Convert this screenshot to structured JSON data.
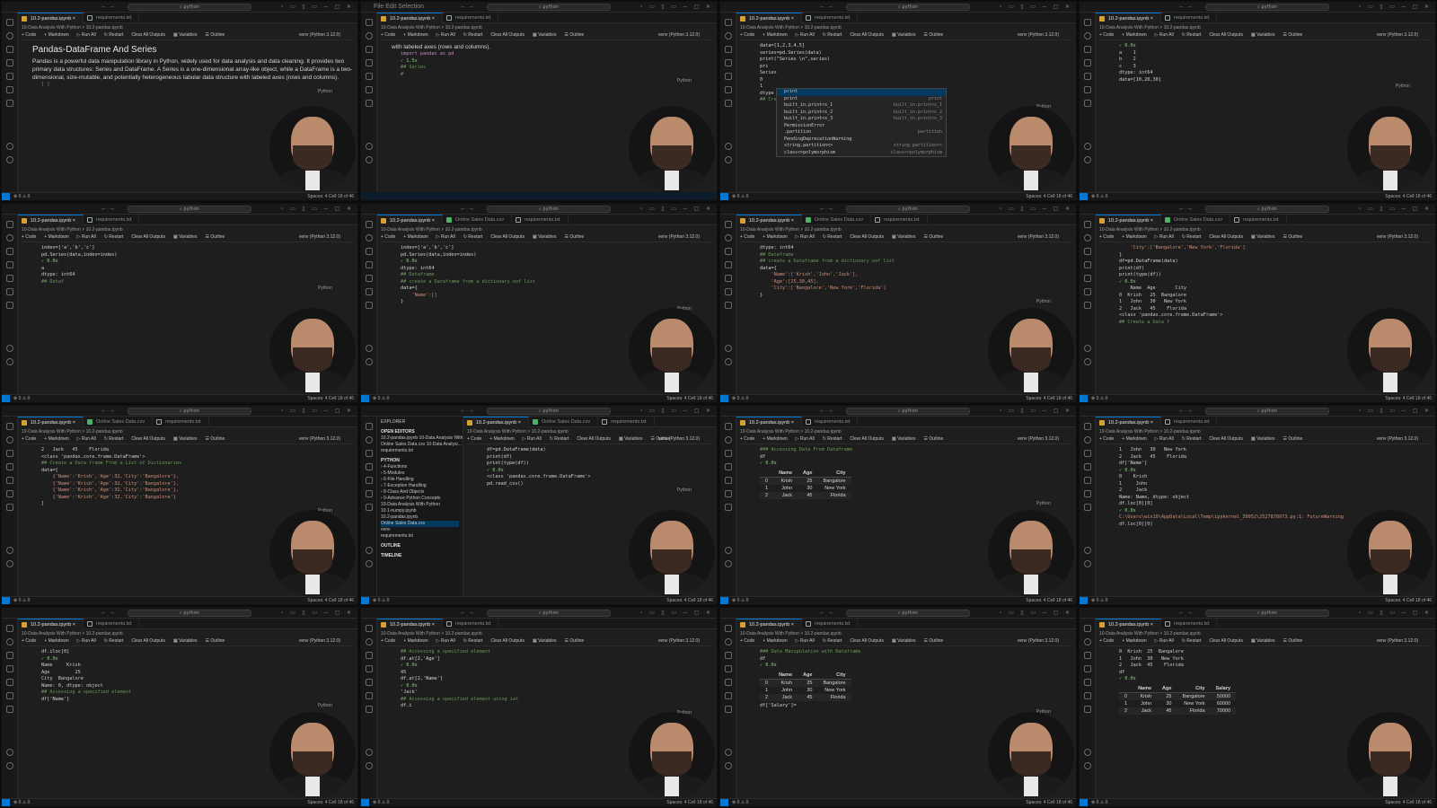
{
  "common": {
    "search": "python",
    "nb_tab": "10.2-pandas.ipynb",
    "req_tab": "requirements.txt",
    "csv_tab": "Online Sales Data.csv",
    "crumbs": "10-Data Analysis With Python > 10.2-pandas.ipynb",
    "tb_code": "+ Code",
    "tb_md": "+ Markdown",
    "tb_run": "Run All",
    "tb_restart": "Restart",
    "tb_clear": "Clear All Outputs",
    "tb_vars": "Variables",
    "tb_outline": "Outline",
    "kernel": "venv (Python 3.12.0)",
    "lang": "Python",
    "status_left": "⊗ 0 ⚠ 0",
    "status_right": "Spaces: 4   Cell 18 of 46",
    "menu": "File  Edit  Selection"
  },
  "explorer": {
    "header": "EXPLORER",
    "open_editors": "OPEN EDITORS",
    "items": [
      "10.2-pandas.ipynb  10-Data Analysis With Py...",
      "Online Sales Data.csv  10-Data Analysi...",
      "requirements.txt",
      "PYTHON",
      "4-Functions",
      "5-Modules",
      "6-File Handling",
      "7-Exception Handling",
      "8-Class And Objects",
      "9-Advance Python Concepts",
      "10-Data Analysis With Python",
      "10.1-numpy.ipynb",
      "10.2-pandas.ipynb",
      "Online Sales Data.csv",
      "venv",
      "requirements.txt"
    ],
    "outline": "OUTLINE",
    "timeline": "TIMELINE"
  },
  "suggest": [
    {
      "label": "print",
      "detail": ""
    },
    {
      "label": "print",
      "detail": "print"
    },
    {
      "label": "built_in.print<s_1",
      "detail": "built_in.print<s_1"
    },
    {
      "label": "built_in.print<s_2",
      "detail": "built_in.print<s_2"
    },
    {
      "label": "built_in.print<s_3",
      "detail": "built_in.print<s_3"
    },
    {
      "label": "PermissionError",
      "detail": ""
    },
    {
      "label": ".partition",
      "detail": "partition"
    },
    {
      "label": "PendingDeprecationWarning",
      "detail": ""
    },
    {
      "label": "string.partition<>",
      "detail": "string.partition<>"
    },
    {
      "label": "class<>polymorphism",
      "detail": "class<>polymorphism"
    }
  ],
  "panels": [
    {
      "lines": [
        {
          "c": "h",
          "t": "Pandas-DataFrame And Series"
        },
        {
          "c": "md",
          "t": "Pandas is a powerful data manipulation library in Python, widely used for data analysis and data cleaning. It provides two primary data structures: Series and DataFrame. A Series is a one-dimensional array-like object, while a DataFrame is a two-dimensional, size-mutable, and potentially heterogeneous tabular data structure with labeled axes (rows and columns)."
        },
        {
          "c": "cellbar",
          "t": "[ ]"
        }
      ]
    },
    {
      "lines": [
        {
          "c": "md",
          "t": "with labeled axes (rows and columns)."
        },
        {
          "c": "kw",
          "t": "import pandas as pd"
        },
        {
          "c": "ok",
          "t": "✓ 1.5s"
        },
        {
          "c": "cmt",
          "t": "## Series"
        },
        {
          "c": "cmt",
          "t": "#"
        }
      ]
    },
    {
      "lines": [
        {
          "c": "",
          "t": "data=[1,2,3,4,5]"
        },
        {
          "c": "",
          "t": "series=pd.Series(data)"
        },
        {
          "c": "",
          "t": "print(\"Series \\n\",series)"
        },
        {
          "c": "",
          "t": "pri"
        },
        {
          "c": "out",
          "t": "Series"
        },
        {
          "c": "out",
          "t": "0"
        },
        {
          "c": "out",
          "t": "1"
        },
        {
          "c": "out",
          "t": "dtype"
        },
        {
          "c": "cmt",
          "t": "## Create a Series from dictionary"
        }
      ]
    },
    {
      "lines": [
        {
          "c": "ok",
          "t": "✓ 0.0s"
        },
        {
          "c": "out",
          "t": "a    1"
        },
        {
          "c": "out",
          "t": "b    2"
        },
        {
          "c": "out",
          "t": "c    3"
        },
        {
          "c": "out",
          "t": "dtype: int64"
        },
        {
          "c": "",
          "t": "data=[10,20,30]"
        }
      ]
    },
    {
      "lines": [
        {
          "c": "",
          "t": "index=['a','b','c']"
        },
        {
          "c": "",
          "t": "pd.Series(data,index=index)"
        },
        {
          "c": "ok",
          "t": "✓ 0.0s"
        },
        {
          "c": "out",
          "t": "a"
        },
        {
          "c": "out",
          "t": "dtype: int64"
        },
        {
          "c": "cmt",
          "t": "## Dataf"
        }
      ]
    },
    {
      "lines": [
        {
          "c": "",
          "t": "index=['a','b','c']"
        },
        {
          "c": "",
          "t": "pd.Series(data,index=index)"
        },
        {
          "c": "ok",
          "t": "✓ 0.0s"
        },
        {
          "c": "out",
          "t": "dtype: int64"
        },
        {
          "c": "cmt",
          "t": "## Dataframe"
        },
        {
          "c": "cmt",
          "t": "## create a Dataframe from a dictionary oof list"
        },
        {
          "c": "",
          "t": "data={"
        },
        {
          "c": "str",
          "t": "    'Name':[]"
        },
        {
          "c": "",
          "t": "}"
        }
      ]
    },
    {
      "lines": [
        {
          "c": "out",
          "t": "dtype: int64"
        },
        {
          "c": "cmt",
          "t": "## Dataframe"
        },
        {
          "c": "cmt",
          "t": "## create a Dataframe from a dictionary oof list"
        },
        {
          "c": "",
          "t": "data={"
        },
        {
          "c": "str",
          "t": "    'Name':['Krish','John','Jack'],"
        },
        {
          "c": "str",
          "t": "    'Age':[25,30,45],"
        },
        {
          "c": "str",
          "t": "    'City':['Bangalore','New York','Florida']"
        },
        {
          "c": "",
          "t": "}"
        }
      ]
    },
    {
      "lines": [
        {
          "c": "str",
          "t": "    'City':['Bangalore','New York','Florida']"
        },
        {
          "c": "",
          "t": "}"
        },
        {
          "c": "",
          "t": "df=pd.DataFrame(data)"
        },
        {
          "c": "",
          "t": "print(df)"
        },
        {
          "c": "",
          "t": "print(type(df))"
        },
        {
          "c": "ok",
          "t": "✓ 0.0s"
        },
        {
          "c": "out",
          "t": "    Name  Age       City"
        },
        {
          "c": "out",
          "t": "0  Krish   25  Bangalore"
        },
        {
          "c": "out",
          "t": "1   John   30   New York"
        },
        {
          "c": "out",
          "t": "2   Jack   45    Florida"
        },
        {
          "c": "out",
          "t": "<class 'pandas.core.frame.DataFrame'>"
        },
        {
          "c": "cmt",
          "t": "## Create a Data f"
        }
      ]
    },
    {
      "lines": [
        {
          "c": "out",
          "t": "2   Jack   45    Florida"
        },
        {
          "c": "out",
          "t": "<class 'pandas.core.frame.DataFrame'>"
        },
        {
          "c": "cmt",
          "t": "## Create a Data frame From a List of Dictionaries"
        },
        {
          "c": "",
          "t": "data=["
        },
        {
          "c": "str",
          "t": "    {'Name':'Krish','Age':32,'City':'Bangalore'},"
        },
        {
          "c": "str",
          "t": "    {'Name':'Krish','Age':32,'City':'Bangalore'},"
        },
        {
          "c": "str",
          "t": "    {'Name':'Krish','Age':32,'City':'Bangalore'},"
        },
        {
          "c": "str",
          "t": "    {'Name':'Krish','Age':32,'City':'Bangalore'}"
        },
        {
          "c": "",
          "t": "]"
        }
      ]
    },
    {
      "lines": [
        {
          "c": "",
          "t": "df=pd.DataFrame(data)"
        },
        {
          "c": "",
          "t": "print(df)"
        },
        {
          "c": "",
          "t": "print(type(df))"
        },
        {
          "c": "ok",
          "t": "✓ 0.0s"
        },
        {
          "c": "out",
          "t": "<class 'pandas.core.frame.DataFrame'>"
        },
        {
          "c": "",
          "t": "pd.read_csv()"
        }
      ]
    },
    {
      "lines": [
        {
          "c": "cmt",
          "t": "### Accessing Data From Dataframe"
        },
        {
          "c": "",
          "t": "df"
        },
        {
          "c": "ok",
          "t": "✓ 0.0s"
        }
      ],
      "table": {
        "cols": [
          "",
          "Name",
          "Age",
          "City"
        ],
        "rows": [
          [
            "0",
            "Krish",
            "25",
            "Bangalore"
          ],
          [
            "1",
            "John",
            "30",
            "New York"
          ],
          [
            "2",
            "Jack",
            "45",
            "Florida"
          ]
        ]
      }
    },
    {
      "lines": [
        {
          "c": "out",
          "t": "1   John   30   New York"
        },
        {
          "c": "out",
          "t": "2   Jack   45    Florida"
        },
        {
          "c": "",
          "t": "df['Name']"
        },
        {
          "c": "ok",
          "t": "✓ 0.0s"
        },
        {
          "c": "out",
          "t": "0    Krish"
        },
        {
          "c": "out",
          "t": "1     John"
        },
        {
          "c": "out",
          "t": "2     Jack"
        },
        {
          "c": "out",
          "t": "Name: Name, dtype: object"
        },
        {
          "c": "",
          "t": "df.loc[0][0]"
        },
        {
          "c": "ok",
          "t": "✓ 0.0s"
        },
        {
          "c": "str",
          "t": "C:\\Users\\win10\\AppData\\Local\\Temp\\ipykernel_30952\\2527878973.py:1: FutureWarning"
        },
        {
          "c": "out",
          "t": "df.loc[0][0]"
        }
      ]
    },
    {
      "lines": [
        {
          "c": "",
          "t": "df.iloc[0]"
        },
        {
          "c": "ok",
          "t": "✓ 0.0s"
        },
        {
          "c": "out",
          "t": "Name     Krish"
        },
        {
          "c": "out",
          "t": "Age         25"
        },
        {
          "c": "out",
          "t": "City  Bangalore"
        },
        {
          "c": "out",
          "t": "Name: 0, dtype: object"
        },
        {
          "c": "cmt",
          "t": "## Accessing a specified element"
        },
        {
          "c": "",
          "t": "df['Name']"
        }
      ]
    },
    {
      "lines": [
        {
          "c": "cmt",
          "t": "## Accessing a specified element"
        },
        {
          "c": "",
          "t": "df.at[2,'Age']"
        },
        {
          "c": "ok",
          "t": "✓ 0.0s"
        },
        {
          "c": "out",
          "t": "45"
        },
        {
          "c": "",
          "t": "df.at[2,'Name']"
        },
        {
          "c": "ok",
          "t": "✓ 0.0s"
        },
        {
          "c": "out",
          "t": "'Jack'"
        },
        {
          "c": "cmt",
          "t": "## Accessing a specified element using iat"
        },
        {
          "c": "",
          "t": "df.i"
        }
      ]
    },
    {
      "lines": [
        {
          "c": "cmt",
          "t": "### Data Manipulation with Dataframe"
        },
        {
          "c": "",
          "t": "df"
        },
        {
          "c": "ok",
          "t": "✓ 0.0s"
        }
      ],
      "table": {
        "cols": [
          "",
          "Name",
          "Age",
          "City"
        ],
        "rows": [
          [
            "0",
            "Krish",
            "25",
            "Bangalore"
          ],
          [
            "1",
            "John",
            "30",
            "New York"
          ],
          [
            "2",
            "Jack",
            "45",
            "Florida"
          ]
        ]
      },
      "after": [
        {
          "c": "",
          "t": "df['Salary']="
        }
      ]
    },
    {
      "lines": [
        {
          "c": "out",
          "t": "0  Krish  25  Bangalore"
        },
        {
          "c": "out",
          "t": "1   John  30   New York"
        },
        {
          "c": "out",
          "t": "2   Jack  45    Florida"
        },
        {
          "c": "",
          "t": "df"
        },
        {
          "c": "ok",
          "t": "✓ 0.0s"
        }
      ],
      "table": {
        "cols": [
          "",
          "Name",
          "Age",
          "City",
          "Salary"
        ],
        "rows": [
          [
            "0",
            "Krish",
            "25",
            "Bangalore",
            "50000"
          ],
          [
            "1",
            "John",
            "30",
            "New York",
            "60000"
          ],
          [
            "2",
            "Jack",
            "45",
            "Florida",
            "70000"
          ]
        ]
      }
    }
  ]
}
